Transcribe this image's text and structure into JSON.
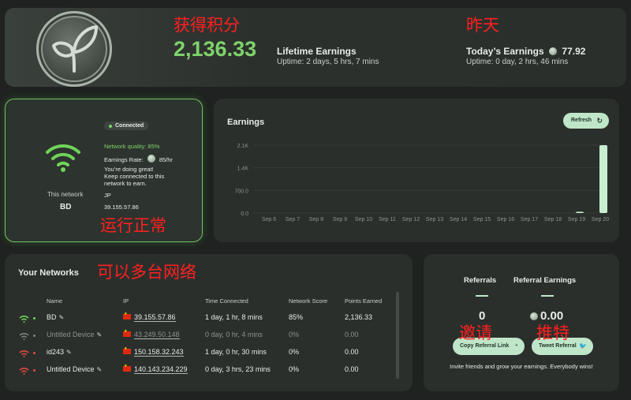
{
  "annotations": {
    "points_earned": "获得积分",
    "yesterday": "昨天",
    "running_normal": "运行正常",
    "multi_network": "可以多台网络",
    "invite": "邀请",
    "twitter": "推特"
  },
  "summary": {
    "lifetime_value": "2,136.33",
    "lifetime_label": "Lifetime Earnings",
    "lifetime_uptime": "Uptime: 2 days, 5 hrs, 7 mins",
    "today_label": "Today’s Earnings",
    "today_value": "77.92",
    "today_uptime": "Uptime: 0 day, 2 hrs, 46 mins"
  },
  "status": {
    "badge": "Connected",
    "quality": "Network quality: 85%",
    "rate_label": "Earnings Rate:",
    "rate_value": "85/hr",
    "message_1": "You’re doing great!",
    "message_2": "Keep connected to this",
    "message_3": "network to earn.",
    "country": "JP",
    "ip": "39.155.57.86",
    "this_network_label": "This network",
    "network_name": "BD"
  },
  "earnings": {
    "title": "Earnings",
    "refresh_label": "Refresh"
  },
  "chart_data": {
    "type": "bar",
    "categories": [
      "Sep 6",
      "Sep 7",
      "Sep 8",
      "Sep 9",
      "Sep 10",
      "Sep 11",
      "Sep 12",
      "Sep 13",
      "Sep 14",
      "Sep 15",
      "Sep 16",
      "Sep 17",
      "Sep 18",
      "Sep 19",
      "Sep 20"
    ],
    "values": [
      0,
      0,
      0,
      0,
      0,
      0,
      0,
      0,
      0,
      0,
      0,
      0,
      0,
      40,
      2100
    ],
    "yticks": [
      "2.1K",
      "1.4K",
      "700.0",
      "0.0"
    ],
    "ytick_values": [
      2100,
      1400,
      700,
      0
    ],
    "ylim": [
      0,
      2100
    ],
    "grid": true,
    "colors": {
      "bar": "#c9efd1",
      "axis": "#8c938d"
    }
  },
  "networks": {
    "title": "Your Networks",
    "headers": {
      "name": "Name",
      "ip": "IP",
      "time": "Time Connected",
      "score": "Network Score",
      "points": "Points Earned"
    },
    "rows": [
      {
        "name": "BD",
        "ip": "39.155.57.86",
        "time": "1 day, 1 hr, 8 mins",
        "score": "85%",
        "points": "2,136.33",
        "status": "good"
      },
      {
        "name": "Untitled Device",
        "ip": "43.249.50.148",
        "time": "0 day, 0 hr, 4 mins",
        "score": "0%",
        "points": "0.00",
        "status": "offline"
      },
      {
        "name": "id243",
        "ip": "150.158.32.243",
        "time": "1 day, 0 hr, 30 mins",
        "score": "0%",
        "points": "0.00",
        "status": "bad"
      },
      {
        "name": "Untitled Device",
        "ip": "140.143.234.229",
        "time": "0 day, 3 hrs, 23 mins",
        "score": "0%",
        "points": "0.00",
        "status": "bad"
      }
    ]
  },
  "referrals": {
    "referrals_label": "Referrals",
    "earnings_label": "Referral Earnings",
    "referrals_value": "0",
    "earnings_value": "0.00",
    "copy_link_label": "Copy Referral Link",
    "tweet_label": "Tweet Referral",
    "note": "Invite friends and grow your earnings. Everybody wins!"
  },
  "colors": {
    "accent_green": "#7ed36a",
    "button_bg": "#bfe6c8",
    "bad_red": "#e24a3b",
    "annotation_red": "#ff2020"
  }
}
